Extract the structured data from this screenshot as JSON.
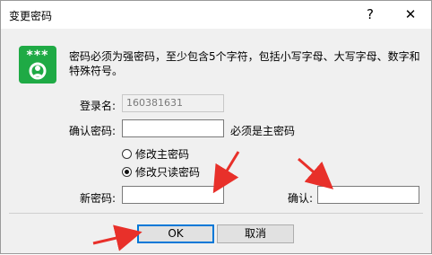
{
  "window": {
    "title": "变更密码",
    "help_glyph": "?",
    "close_glyph": "✕"
  },
  "icon": {
    "name": "password-user-icon",
    "stars": "***",
    "color": "#1faa45"
  },
  "description": "密码必须为强密码，至少包含5个字符，包括小写字母、大写字母、数字和特殊符号。",
  "login": {
    "label": "登录名:",
    "value": "160381631"
  },
  "confirm_password": {
    "label": "确认密码:",
    "value": "",
    "hint": "必须是主密码"
  },
  "options": [
    {
      "label": "修改主密码",
      "checked": false
    },
    {
      "label": "修改只读密码",
      "checked": true
    }
  ],
  "new_password": {
    "label": "新密码:",
    "value": ""
  },
  "confirm": {
    "label": "确认:",
    "value": ""
  },
  "buttons": {
    "ok": "OK",
    "cancel": "取消"
  },
  "annotation_color": "#e8302a"
}
